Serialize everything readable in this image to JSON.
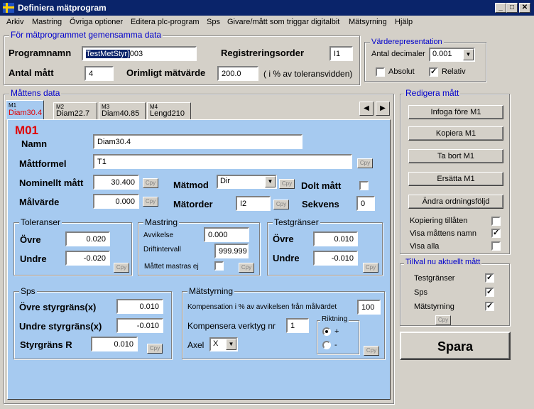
{
  "window": {
    "title": "Definiera mätprogram"
  },
  "menu": [
    "Arkiv",
    "Mastring",
    "Övriga optioner",
    "Editera plc-program",
    "Sps",
    "Givare/mått som triggar digitalbit",
    "Mätsyrning",
    "Hjälp"
  ],
  "common": {
    "group_title": "För mätprogrammet gemensamma data",
    "programnamn_label": "Programnamn",
    "programnamn_selected": "TestMetStyr)",
    "programnamn_rest": "003",
    "registreringsorder_label": "Registreringsorder",
    "registreringsorder_value": "I1",
    "antal_matt_label": "Antal mått",
    "antal_matt_value": "4",
    "orimligt_label": "Orimligt mätvärde",
    "orimligt_value": "200.0",
    "orimligt_suffix": "( i % av toleransvidden)"
  },
  "vardere": {
    "title": "Värderepresentation",
    "decimaler_label": "Antal decimaler",
    "decimaler_value": "0.001",
    "absolut_label": "Absolut",
    "absolut_checked": false,
    "relativ_label": "Relativ",
    "relativ_checked": true
  },
  "mattens": {
    "group_title": "Måttens data",
    "tabs": [
      {
        "num": "M1",
        "name": "Diam30.4"
      },
      {
        "num": "M2",
        "name": "Diam22.7"
      },
      {
        "num": "M3",
        "name": "Diam40.85"
      },
      {
        "num": "M4",
        "name": "Lengd210"
      }
    ],
    "nav_prev": "◀",
    "nav_next": "▶",
    "heading": "M01",
    "namn_label": "Namn",
    "namn_value": "Diam30.4",
    "mattformel_label": "Måttformel",
    "mattformel_value": "T1",
    "nominellt_label": "Nominellt mått",
    "nominellt_value": "30.400",
    "matmod_label": "Mätmod",
    "matmod_value": "Dir",
    "dolt_label": "Dolt mått",
    "malvarde_label": "Målvärde",
    "malvarde_value": "0.000",
    "matorder_label": "Mätorder",
    "matorder_value": "I2",
    "sekvens_label": "Sekvens",
    "sekvens_value": "0",
    "cpy": "Cpy"
  },
  "toleranser": {
    "title": "Toleranser",
    "ovre_label": "Övre",
    "ovre_value": "0.020",
    "undre_label": "Undre",
    "undre_value": "-0.020"
  },
  "mastring": {
    "title": "Mastring",
    "avvikelse_label": "Avvikelse",
    "avvikelse_value": "0.000",
    "drift_label": "Driftintervall",
    "drift_value": "999.999",
    "mastras_label": "Måttet mastras ej"
  },
  "testgranser": {
    "title": "Testgränser",
    "ovre_label": "Övre",
    "ovre_value": "0.010",
    "undre_label": "Undre",
    "undre_value": "-0.010"
  },
  "sps": {
    "title": "Sps",
    "ovre_label": "Övre styrgräns(x)",
    "ovre_value": "0.010",
    "undre_label": "Undre styrgräns(x)",
    "undre_value": "-0.010",
    "r_label": "Styrgräns R",
    "r_value": "0.010"
  },
  "matstyrning": {
    "title": "Mätstyrning",
    "komp_label": "Kompensation i % av avvikelsen från målvärdet",
    "komp_value": "100",
    "verktyg_label": "Kompensera verktyg nr",
    "verktyg_value": "1",
    "axel_label": "Axel",
    "axel_value": "X",
    "riktning_title": "Riktning",
    "plus": "+",
    "minus": "-"
  },
  "redigera": {
    "title": "Redigera mått",
    "buttons": [
      "Infoga före M1",
      "Kopiera M1",
      "Ta bort M1",
      "Ersätta M1",
      "Ändra ordningsföljd"
    ],
    "checks": [
      {
        "label": "Kopiering tillåten",
        "checked": false
      },
      {
        "label": "Visa måttens namn",
        "checked": true
      },
      {
        "label": "Visa alla",
        "checked": false
      }
    ]
  },
  "tillval": {
    "title": "Tillval nu aktuellt mått",
    "checks": [
      {
        "label": "Testgränser",
        "checked": true
      },
      {
        "label": "Sps",
        "checked": true
      },
      {
        "label": "Mätstyrning",
        "checked": true
      }
    ]
  },
  "spara": "Spara"
}
